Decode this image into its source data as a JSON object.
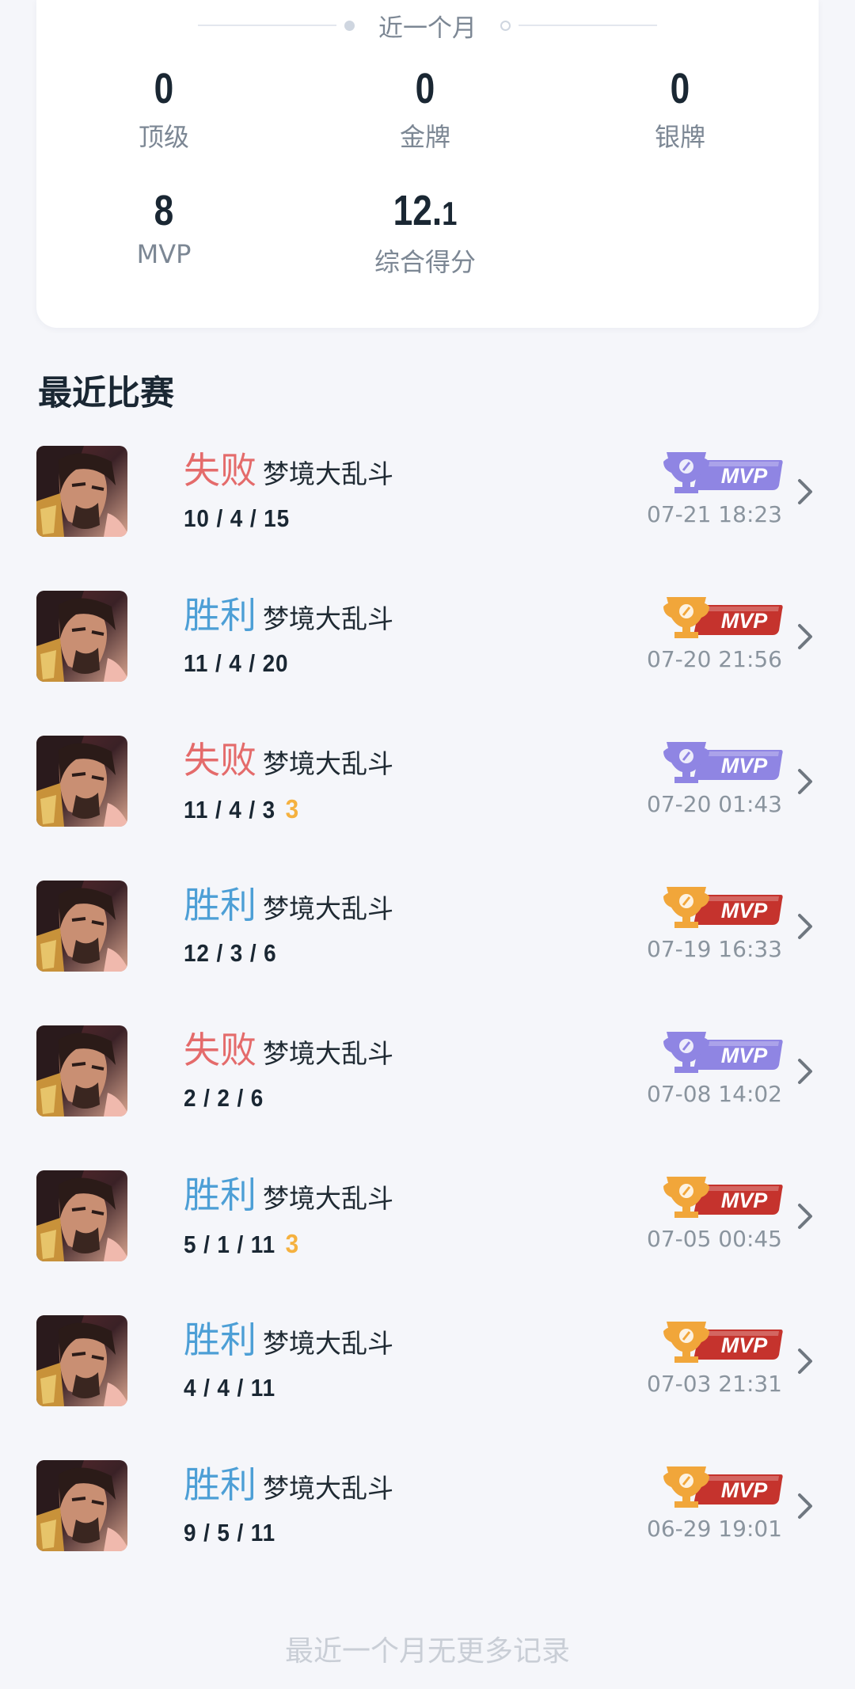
{
  "stats": {
    "period_label": "近一个月",
    "items": [
      {
        "value": "0",
        "label": "顶级"
      },
      {
        "value": "0",
        "label": "金牌"
      },
      {
        "value": "0",
        "label": "银牌"
      },
      {
        "value": "8",
        "label": "MVP"
      },
      {
        "value_main": "12.",
        "value_small": "1",
        "label": "综合得分"
      }
    ]
  },
  "recent": {
    "title": "最近比赛",
    "mvp_label": "MVP",
    "matches": [
      {
        "result": "失败",
        "outcome": "lose",
        "mode": "梦境大乱斗",
        "kda": "10 / 4 / 15",
        "badge": "",
        "mvp_color": "purple",
        "time": "07-21 18:23"
      },
      {
        "result": "胜利",
        "outcome": "win",
        "mode": "梦境大乱斗",
        "kda": "11 / 4 / 20",
        "badge": "",
        "mvp_color": "gold",
        "time": "07-20 21:56"
      },
      {
        "result": "失败",
        "outcome": "lose",
        "mode": "梦境大乱斗",
        "kda": "11 / 4 / 3",
        "badge": "3",
        "mvp_color": "purple",
        "time": "07-20 01:43"
      },
      {
        "result": "胜利",
        "outcome": "win",
        "mode": "梦境大乱斗",
        "kda": "12 / 3 / 6",
        "badge": "",
        "mvp_color": "gold",
        "time": "07-19 16:33"
      },
      {
        "result": "失败",
        "outcome": "lose",
        "mode": "梦境大乱斗",
        "kda": "2 / 2 / 6",
        "badge": "",
        "mvp_color": "purple",
        "time": "07-08 14:02"
      },
      {
        "result": "胜利",
        "outcome": "win",
        "mode": "梦境大乱斗",
        "kda": "5 / 1 / 11",
        "badge": "3",
        "mvp_color": "gold",
        "time": "07-05 00:45"
      },
      {
        "result": "胜利",
        "outcome": "win",
        "mode": "梦境大乱斗",
        "kda": "4 / 4 / 11",
        "badge": "",
        "mvp_color": "gold",
        "time": "07-03 21:31"
      },
      {
        "result": "胜利",
        "outcome": "win",
        "mode": "梦境大乱斗",
        "kda": "9 / 5 / 11",
        "badge": "",
        "mvp_color": "gold",
        "time": "06-29 19:01"
      }
    ]
  },
  "colors": {
    "lose": "#e46b6b",
    "win": "#4d9fd6",
    "mvp_purple": "#8f85e3",
    "mvp_gold_cup": "#f1a63a",
    "mvp_gold_plate": "#c5332d",
    "multikill_badge": "#f5b13f"
  },
  "icons": {
    "avatar": "hero-portrait-icon",
    "mvp": "trophy-mvp-icon",
    "chevron": "chevron-right-icon"
  },
  "footer": {
    "text": "最近一个月无更多记录"
  }
}
